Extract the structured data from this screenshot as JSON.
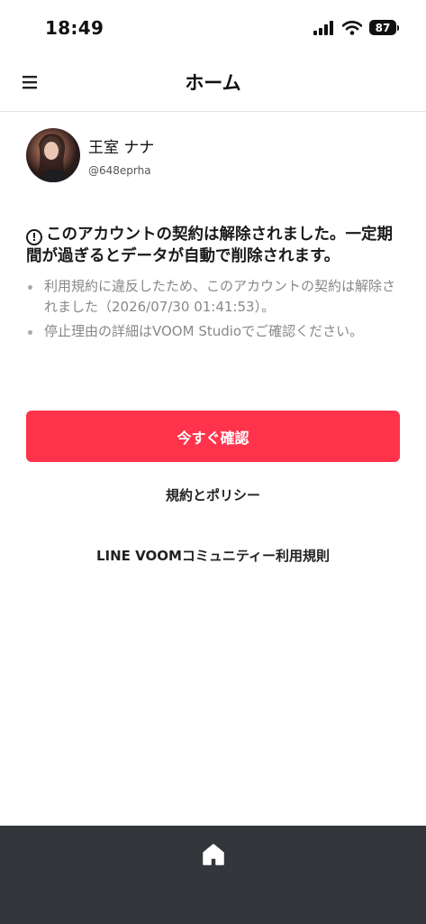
{
  "status_bar": {
    "time": "18:49",
    "battery": "87",
    "icons": [
      "signal-icon",
      "wifi-icon",
      "battery-icon"
    ]
  },
  "header": {
    "title": "ホーム",
    "menu_icon": "menu-icon"
  },
  "profile": {
    "name": "王室 ナナ",
    "handle": "@648eprha"
  },
  "notice": {
    "icon": "!",
    "title": "このアカウントの契約は解除されました。一定期間が過ぎるとデータが自動で削除されます。",
    "bullets": [
      "利用規約に違反したため、このアカウントの契約は解除されました（2026/07/30 01:41:53）。",
      "停止理由の詳細はVOOM Studioでご確認ください。"
    ]
  },
  "actions": {
    "confirm_label": "今すぐ確認",
    "policy_link": "規約とポリシー",
    "community_link": "LINE VOOMコミュニティー利用規則"
  },
  "colors": {
    "accent": "#ff334b",
    "nav_background": "#33363b"
  }
}
